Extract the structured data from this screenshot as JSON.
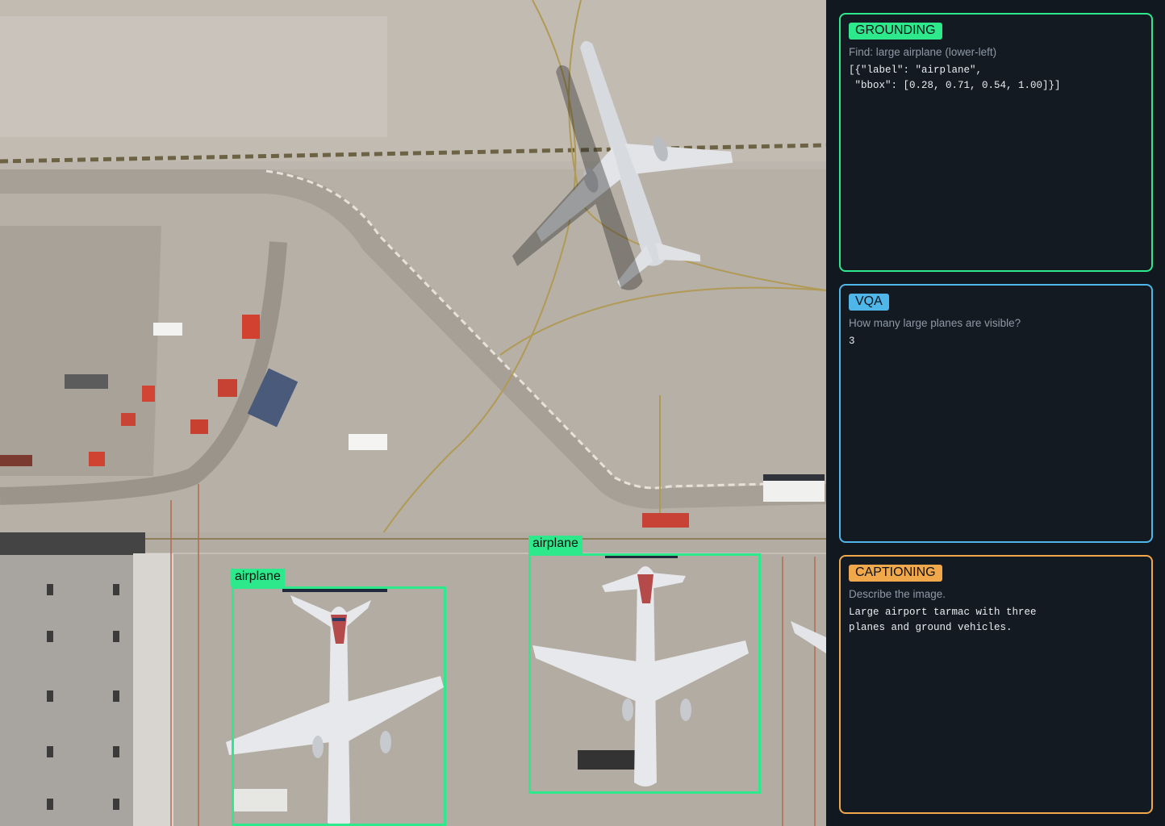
{
  "image": {
    "detections": [
      {
        "label": "airplane"
      },
      {
        "label": "airplane"
      }
    ]
  },
  "panels": {
    "grounding": {
      "tag": "GROUNDING",
      "prompt": "Find: large airplane (lower-left)",
      "answer": "[{\"label\": \"airplane\",\n \"bbox\": [0.28, 0.71, 0.54, 1.00]}]",
      "color": "#2ee88c"
    },
    "vqa": {
      "tag": "VQA",
      "prompt": "How many large planes are visible?",
      "answer": "3",
      "color": "#4fb6ea"
    },
    "captioning": {
      "tag": "CAPTIONING",
      "prompt": "Describe the image.",
      "answer": "Large airport tarmac with three\nplanes and ground vehicles.",
      "color": "#f0a84a"
    }
  }
}
